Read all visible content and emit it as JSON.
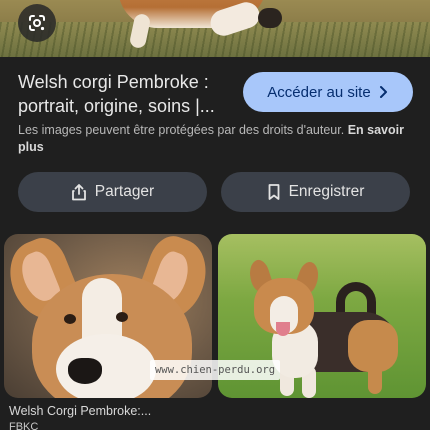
{
  "result": {
    "title": "Welsh corgi Pembroke : portrait, origine, soins |...",
    "visit_label": "Accéder au site",
    "copyright_text": "Les images peuvent être protégées par des droits d'auteur.",
    "learn_more": "En savoir plus"
  },
  "actions": {
    "share_label": "Partager",
    "save_label": "Enregistrer"
  },
  "related": {
    "items": [
      {
        "caption": "Welsh Corgi Pembroke:...",
        "source": "FBKC"
      },
      {
        "watermark": "www.chien-perdu.org"
      }
    ]
  },
  "icons": {
    "lens": "google-lens-icon",
    "visit": "chevron-right-icon",
    "share": "share-icon",
    "save": "bookmark-icon"
  },
  "colors": {
    "background": "#1f1f1f",
    "visit_button": "#a8c7fa",
    "action_button": "#3b4049"
  }
}
